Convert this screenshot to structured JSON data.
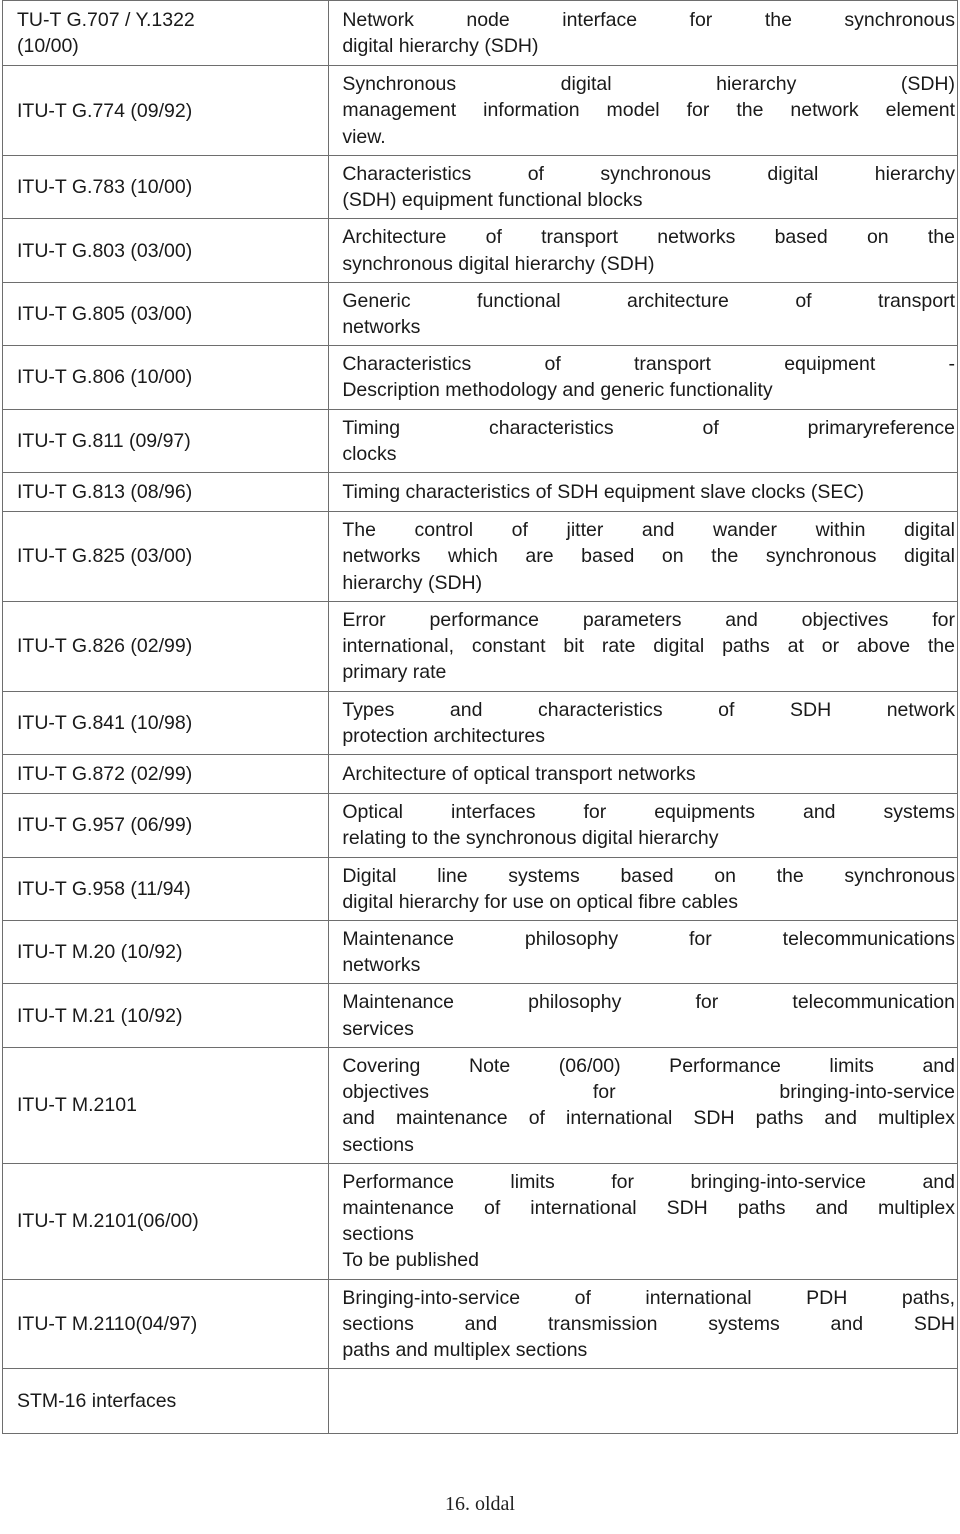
{
  "document": {
    "page_footer": "16. oldal"
  },
  "table": {
    "rows": [
      {
        "ref": "TU-T G.707 / Y.1322 (10/00)",
        "ref_lines": [
          "TU-T    G.707    /    Y.1322",
          "(10/00)"
        ],
        "desc": "Network node interface for the synchronous digital hierarchy (SDH)",
        "desc_lines": [
          "Network node interface for the synchronous",
          "digital hierarchy (SDH)"
        ]
      },
      {
        "ref": "ITU-T G.774 (09/92)",
        "ref_lines": [
          "ITU-T G.774 (09/92)"
        ],
        "desc": "Synchronous digital hierarchy (SDH) management information model for the network element view.",
        "desc_lines": [
          "Synchronous digital hierarchy (SDH)",
          "management information model for the network element",
          "view."
        ]
      },
      {
        "ref": "ITU-T G.783 (10/00)",
        "ref_lines": [
          "ITU-T G.783 (10/00)"
        ],
        "desc": "Characteristics of synchronous digital hierarchy (SDH) equipment functional blocks",
        "desc_lines": [
          "Characteristics of synchronous digital hierarchy",
          "(SDH) equipment functional blocks"
        ]
      },
      {
        "ref": "ITU-T G.803 (03/00)",
        "ref_lines": [
          "ITU-T G.803 (03/00)"
        ],
        "desc": "Architecture of transport networks based on the synchronous digital hierarchy (SDH)",
        "desc_lines": [
          "Architecture of transport networks based on the",
          "synchronous digital hierarchy (SDH)"
        ]
      },
      {
        "ref": "ITU-T G.805 (03/00)",
        "ref_lines": [
          "ITU-T G.805 (03/00)"
        ],
        "desc": "Generic functional architecture of transport networks",
        "desc_lines": [
          "Generic functional architecture of transport",
          "networks"
        ]
      },
      {
        "ref": "ITU-T G.806 (10/00)",
        "ref_lines": [
          "ITU-T G.806 (10/00)"
        ],
        "desc": "Characteristics of transport equipment - Description methodology and generic functionality",
        "desc_lines": [
          "Characteristics of  transport equipment -",
          "Description methodology and generic functionality"
        ]
      },
      {
        "ref": "ITU-T G.811 (09/97)",
        "ref_lines": [
          "ITU-T G.811 (09/97)"
        ],
        "desc": "Timing characteristics of primaryreference clocks",
        "desc_lines": [
          "Timing characteristics of primaryreference",
          "clocks"
        ]
      },
      {
        "ref": "ITU-T G.813 (08/96)",
        "ref_lines": [
          "ITU-T G.813 (08/96)"
        ],
        "desc": "Timing characteristics of SDH equipment slave clocks (SEC)",
        "desc_lines": [
          "Timing characteristics of SDH equipment slave clocks (SEC)"
        ]
      },
      {
        "ref": "ITU-T G.825 (03/00)",
        "ref_lines": [
          "ITU-T G.825 (03/00)"
        ],
        "desc": "The control of jitter and wander within digital networks which are based on the synchronous digital hierarchy (SDH)",
        "desc_lines": [
          "The control of jitter and wander within digital",
          "networks which are based on the synchronous digital",
          "hierarchy (SDH)"
        ]
      },
      {
        "ref": "ITU-T G.826 (02/99)",
        "ref_lines": [
          "ITU-T G.826 (02/99)"
        ],
        "desc": "Error performance parameters and objectives for international, constant bit rate digital paths at or above the primary rate",
        "desc_lines": [
          "Error performance parameters and objectives for",
          "international, constant bit rate digital paths at or above the",
          "primary rate"
        ]
      },
      {
        "ref": "ITU-T G.841 (10/98)",
        "ref_lines": [
          "ITU-T G.841 (10/98)"
        ],
        "desc": "Types and characteristics of SDH network protection architectures",
        "desc_lines": [
          "Types and characteristics of SDH network",
          "protection architectures"
        ]
      },
      {
        "ref": "ITU-T G.872 (02/99)",
        "ref_lines": [
          "ITU-T G.872 (02/99)"
        ],
        "desc": "Architecture of optical transport networks",
        "desc_lines": [
          "Architecture of optical transport networks"
        ]
      },
      {
        "ref": "ITU-T G.957 (06/99)",
        "ref_lines": [
          "ITU-T G.957 (06/99)"
        ],
        "desc": "Optical interfaces for equipments and systems relating to the synchronous digital hierarchy",
        "desc_lines": [
          "Optical interfaces for equipments and systems",
          "relating to the synchronous digital hierarchy"
        ]
      },
      {
        "ref": "ITU-T G.958 (11/94)",
        "ref_lines": [
          "ITU-T G.958 (11/94)"
        ],
        "desc": "Digital line systems based on the synchronous digital hierarchy for use on optical fibre cables",
        "desc_lines": [
          "Digital line systems based on the synchronous",
          "digital hierarchy for use on optical fibre cables"
        ]
      },
      {
        "ref": "ITU-T M.20 (10/92)",
        "ref_lines": [
          "ITU-T M.20 (10/92)"
        ],
        "desc": "Maintenance philosophy for telecommunications networks",
        "desc_lines": [
          "Maintenance philosophy for telecommunications",
          "networks"
        ]
      },
      {
        "ref": "ITU-T M.21 (10/92)",
        "ref_lines": [
          "ITU-T M.21 (10/92)"
        ],
        "desc": "Maintenance philosophy for telecommunication services",
        "desc_lines": [
          "Maintenance philosophy for telecommunication",
          "services"
        ]
      },
      {
        "ref": "ITU-T M.2101",
        "ref_lines": [
          "ITU-T M.2101"
        ],
        "desc": "Covering Note (06/00) Performance limits and objectives for bringing-into-service and maintenance of international SDH paths and multiplex sections",
        "desc_lines": [
          "Covering Note (06/00) Performance limits and",
          "objectives    for    bringing-into-service",
          "and maintenance of international SDH paths and multiplex",
          "sections"
        ]
      },
      {
        "ref": "ITU-T M.2101(06/00)",
        "ref_lines": [
          "ITU-T M.2101(06/00)"
        ],
        "desc": "Performance limits for bringing-into-service and maintenance of international SDH paths and multiplex sections To be published",
        "desc_lines": [
          "Performance limits for bringing-into-service and",
          "maintenance of international SDH paths and multiplex",
          "sections",
          "To be published"
        ]
      },
      {
        "ref": "ITU-T M.2110(04/97)",
        "ref_lines": [
          "ITU-T M.2110(04/97)"
        ],
        "desc": "Bringing-into-service of international PDH paths, sections and transmission systems and SDH paths and multiplex sections",
        "desc_lines": [
          "Bringing-into-service of international PDH paths,",
          "sections and transmission systems and SDH",
          "paths and multiplex sections"
        ]
      },
      {
        "ref": "STM-16 interfaces",
        "ref_lines": [
          "STM-16 interfaces"
        ],
        "desc": "",
        "desc_lines": []
      }
    ]
  }
}
